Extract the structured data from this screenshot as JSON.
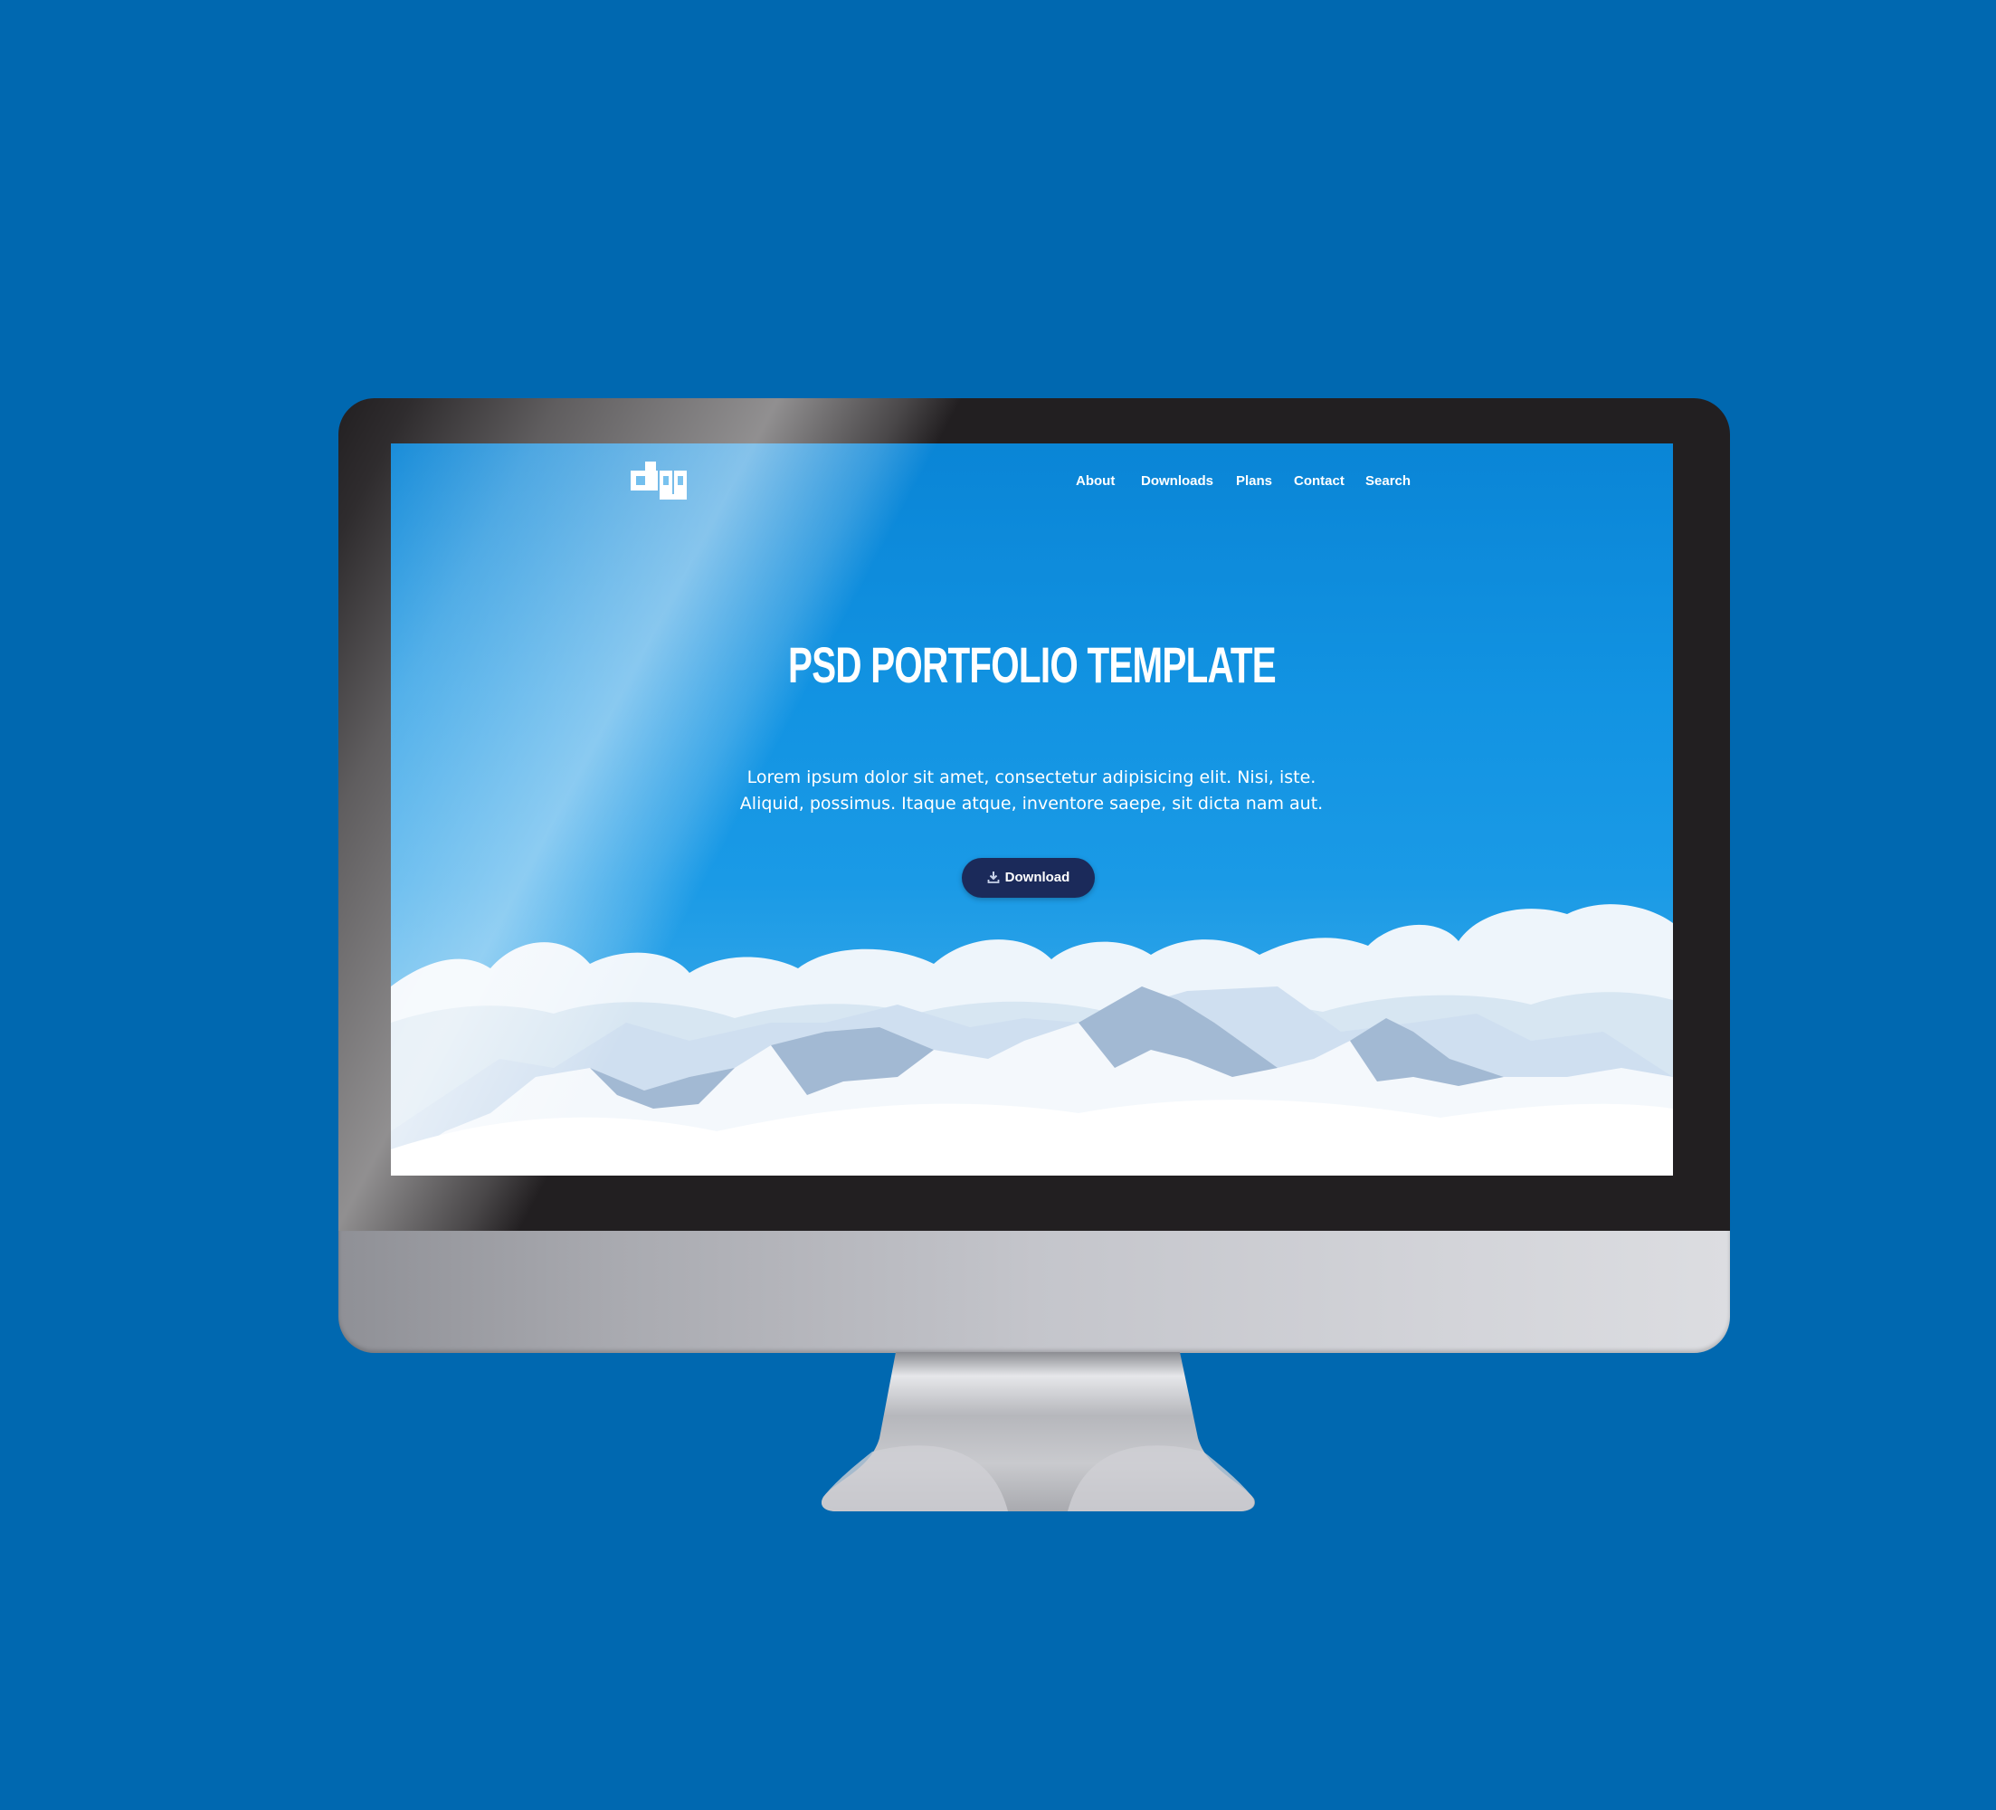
{
  "site": {
    "logo_text": "digg",
    "nav": [
      {
        "label": "About"
      },
      {
        "label": "Downloads"
      },
      {
        "label": "Plans"
      },
      {
        "label": "Contact"
      },
      {
        "label": "Search"
      }
    ],
    "hero": {
      "title": "PSD PORTFOLIO TEMPLATE",
      "text": "Lorem ipsum dolor sit amet, consectetur adipisicing elit. Nisi, iste. Aliquid, possimus. Itaque atque, inventore saepe, sit dicta nam aut.",
      "button_label": "Download",
      "button_icon": "download-icon"
    }
  },
  "colors": {
    "page_background": "#0068b0",
    "sky": "#1293e2",
    "button": "#1b2a5a",
    "bezel": "#221f21"
  }
}
